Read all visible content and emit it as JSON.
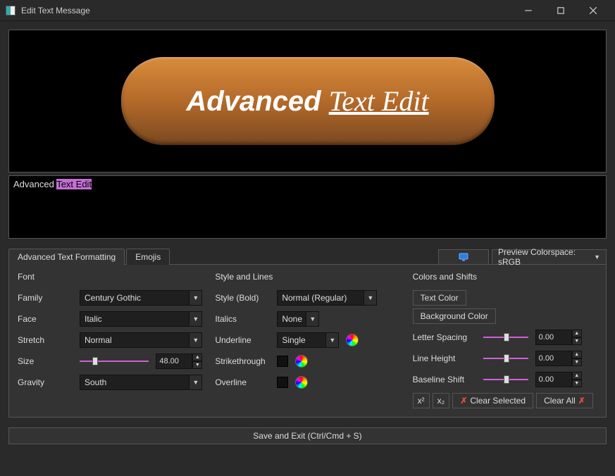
{
  "window": {
    "title": "Edit Text Message"
  },
  "preview": {
    "bold_text": "Advanced ",
    "italic_text": "Text Edit"
  },
  "editor": {
    "plain": "Advanced ",
    "selected": "Text Edit"
  },
  "tabs": {
    "formatting": "Advanced Text Formatting",
    "emojis": "Emojis"
  },
  "toolbar": {
    "preview_cs_label": "Preview Colorspace: sRGB"
  },
  "font": {
    "section": "Font",
    "family_label": "Family",
    "family_value": "Century Gothic",
    "face_label": "Face",
    "face_value": "Italic",
    "stretch_label": "Stretch",
    "stretch_value": "Normal",
    "size_label": "Size",
    "size_value": "48.00",
    "gravity_label": "Gravity",
    "gravity_value": "South"
  },
  "style": {
    "section": "Style and Lines",
    "style_label": "Style (Bold)",
    "style_value": "Normal (Regular)",
    "italics_label": "Italics",
    "italics_value": "None",
    "underline_label": "Underline",
    "underline_value": "Single",
    "strike_label": "Strikethrough",
    "overline_label": "Overline"
  },
  "colors": {
    "section": "Colors and Shifts",
    "text_color": "Text Color",
    "bg_color": "Background Color",
    "letter_spacing_label": "Letter Spacing",
    "letter_spacing_value": "0.00",
    "line_height_label": "Line Height",
    "line_height_value": "0.00",
    "baseline_label": "Baseline Shift",
    "baseline_value": "0.00",
    "sup": "x²",
    "sub": "x₂",
    "clear_selected": "Clear Selected",
    "clear_all": "Clear All"
  },
  "footer": {
    "save": "Save and Exit (Ctrl/Cmd + S)"
  }
}
